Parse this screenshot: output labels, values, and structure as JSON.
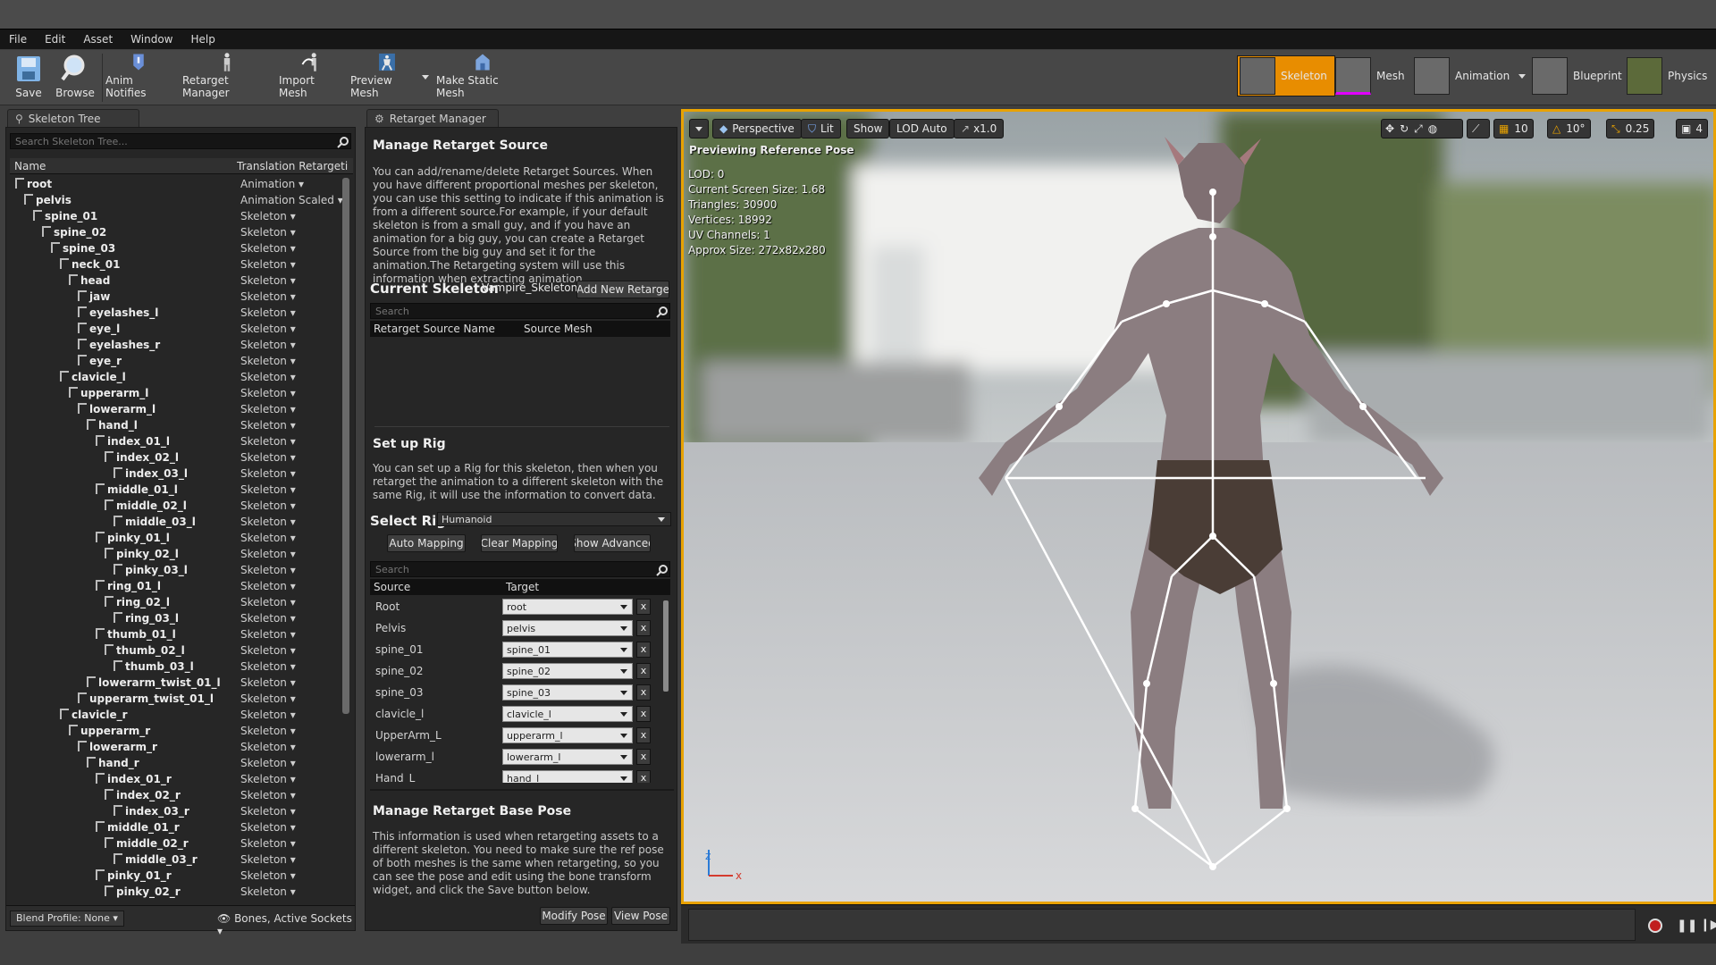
{
  "menu": [
    "File",
    "Edit",
    "Asset",
    "Window",
    "Help"
  ],
  "toolbar": {
    "buttons": [
      "Save",
      "Browse",
      "Anim Notifies",
      "Retarget Manager",
      "Import Mesh",
      "Preview Mesh",
      "Make Static Mesh"
    ],
    "modes": [
      "Skeleton",
      "Mesh",
      "Animation",
      "Blueprint",
      "Physics"
    ]
  },
  "skeleton_tree": {
    "tab": "Skeleton Tree",
    "search_placeholder": "Search Skeleton Tree...",
    "col_name": "Name",
    "col_retarget": "Translation Retargeti",
    "rows": [
      {
        "name": "root",
        "target": "Animation",
        "depth": 0
      },
      {
        "name": "pelvis",
        "target": "Animation Scaled",
        "depth": 1
      },
      {
        "name": "spine_01",
        "target": "Skeleton",
        "depth": 2
      },
      {
        "name": "spine_02",
        "target": "Skeleton",
        "depth": 3
      },
      {
        "name": "spine_03",
        "target": "Skeleton",
        "depth": 4
      },
      {
        "name": "neck_01",
        "target": "Skeleton",
        "depth": 5
      },
      {
        "name": "head",
        "target": "Skeleton",
        "depth": 6
      },
      {
        "name": "jaw",
        "target": "Skeleton",
        "depth": 7
      },
      {
        "name": "eyelashes_l",
        "target": "Skeleton",
        "depth": 7
      },
      {
        "name": "eye_l",
        "target": "Skeleton",
        "depth": 7
      },
      {
        "name": "eyelashes_r",
        "target": "Skeleton",
        "depth": 7
      },
      {
        "name": "eye_r",
        "target": "Skeleton",
        "depth": 7
      },
      {
        "name": "clavicle_l",
        "target": "Skeleton",
        "depth": 5
      },
      {
        "name": "upperarm_l",
        "target": "Skeleton",
        "depth": 6
      },
      {
        "name": "lowerarm_l",
        "target": "Skeleton",
        "depth": 7
      },
      {
        "name": "hand_l",
        "target": "Skeleton",
        "depth": 8
      },
      {
        "name": "index_01_l",
        "target": "Skeleton",
        "depth": 9
      },
      {
        "name": "index_02_l",
        "target": "Skeleton",
        "depth": 10
      },
      {
        "name": "index_03_l",
        "target": "Skeleton",
        "depth": 11
      },
      {
        "name": "middle_01_l",
        "target": "Skeleton",
        "depth": 9
      },
      {
        "name": "middle_02_l",
        "target": "Skeleton",
        "depth": 10
      },
      {
        "name": "middle_03_l",
        "target": "Skeleton",
        "depth": 11
      },
      {
        "name": "pinky_01_l",
        "target": "Skeleton",
        "depth": 9
      },
      {
        "name": "pinky_02_l",
        "target": "Skeleton",
        "depth": 10
      },
      {
        "name": "pinky_03_l",
        "target": "Skeleton",
        "depth": 11
      },
      {
        "name": "ring_01_l",
        "target": "Skeleton",
        "depth": 9
      },
      {
        "name": "ring_02_l",
        "target": "Skeleton",
        "depth": 10
      },
      {
        "name": "ring_03_l",
        "target": "Skeleton",
        "depth": 11
      },
      {
        "name": "thumb_01_l",
        "target": "Skeleton",
        "depth": 9
      },
      {
        "name": "thumb_02_l",
        "target": "Skeleton",
        "depth": 10
      },
      {
        "name": "thumb_03_l",
        "target": "Skeleton",
        "depth": 11
      },
      {
        "name": "lowerarm_twist_01_l",
        "target": "Skeleton",
        "depth": 8
      },
      {
        "name": "upperarm_twist_01_l",
        "target": "Skeleton",
        "depth": 7
      },
      {
        "name": "clavicle_r",
        "target": "Skeleton",
        "depth": 5
      },
      {
        "name": "upperarm_r",
        "target": "Skeleton",
        "depth": 6
      },
      {
        "name": "lowerarm_r",
        "target": "Skeleton",
        "depth": 7
      },
      {
        "name": "hand_r",
        "target": "Skeleton",
        "depth": 8
      },
      {
        "name": "index_01_r",
        "target": "Skeleton",
        "depth": 9
      },
      {
        "name": "index_02_r",
        "target": "Skeleton",
        "depth": 10
      },
      {
        "name": "index_03_r",
        "target": "Skeleton",
        "depth": 11
      },
      {
        "name": "middle_01_r",
        "target": "Skeleton",
        "depth": 9
      },
      {
        "name": "middle_02_r",
        "target": "Skeleton",
        "depth": 10
      },
      {
        "name": "middle_03_r",
        "target": "Skeleton",
        "depth": 11
      },
      {
        "name": "pinky_01_r",
        "target": "Skeleton",
        "depth": 9
      },
      {
        "name": "pinky_02_r",
        "target": "Skeleton",
        "depth": 10
      }
    ],
    "footer_blend": "Blend Profile: None",
    "footer_show": "Bones, Active Sockets"
  },
  "retarget": {
    "tab": "Retarget Manager",
    "manage_title": "Manage Retarget Source",
    "manage_text": "You can add/rename/delete Retarget Sources. When you have different proportional meshes per skeleton, you can use this setting to indicate if this animation is from a different source.For example, if your default skeleton is from a small guy, and if you have an animation for a big guy, you can create a Retarget Source from the big guy and set it for the animation.The Retargeting system will use this information when extracting animation.",
    "current_skeleton_label": "Current Skeleton",
    "current_skeleton_value": "Vampire_Skeleton",
    "add_new": "Add New Retarge",
    "search": "Search",
    "col_source_name": "Retarget Source Name",
    "col_source_mesh": "Source Mesh",
    "setup_title": "Set up Rig",
    "setup_text": "You can set up a Rig for this skeleton, then when you retarget the animation to a different skeleton with the same Rig, it will use the information to convert data.",
    "select_rig_label": "Select Rig",
    "select_rig_value": "Humanoid",
    "auto_mapping": "Auto  Mapping",
    "clear_mapping": "Clear Mapping",
    "show_advanced": "Show Advanced",
    "col_source": "Source",
    "col_target": "Target",
    "mappings": [
      {
        "source": "Root",
        "target": "root"
      },
      {
        "source": "Pelvis",
        "target": "pelvis"
      },
      {
        "source": "spine_01",
        "target": "spine_01"
      },
      {
        "source": "spine_02",
        "target": "spine_02"
      },
      {
        "source": "spine_03",
        "target": "spine_03"
      },
      {
        "source": "clavicle_l",
        "target": "clavicle_l"
      },
      {
        "source": "UpperArm_L",
        "target": "upperarm_l"
      },
      {
        "source": "lowerarm_l",
        "target": "lowerarm_l"
      },
      {
        "source": "Hand_L",
        "target": "hand_l"
      }
    ],
    "clear_x": "x",
    "base_title": "Manage Retarget Base Pose",
    "base_text": "This information is used when retargeting assets to a different skeleton. You need to make sure the ref pose of both meshes is the same when retargeting, so you can see the pose and edit using the bone transform widget, and click the Save button below.",
    "modify_pose": "Modify Pose",
    "view_pose": "View Pose"
  },
  "viewport": {
    "perspective": "Perspective",
    "lit": "Lit",
    "show": "Show",
    "lod": "LOD Auto",
    "speed": "x1.0",
    "grid": "10",
    "angle": "10°",
    "scale": "0.25",
    "cam": "4",
    "previewing": "Previewing Reference Pose",
    "stats": [
      "LOD: 0",
      "Current Screen Size: 1.68",
      "Triangles: 30900",
      "Vertices: 18992",
      "UV Channels: 1",
      "Approx Size: 272x82x280"
    ],
    "axis_x": "x",
    "axis_z": "z"
  },
  "colors": {
    "accent": "#e8a200",
    "selection": "#f0a000",
    "bone": "#ffffff"
  }
}
